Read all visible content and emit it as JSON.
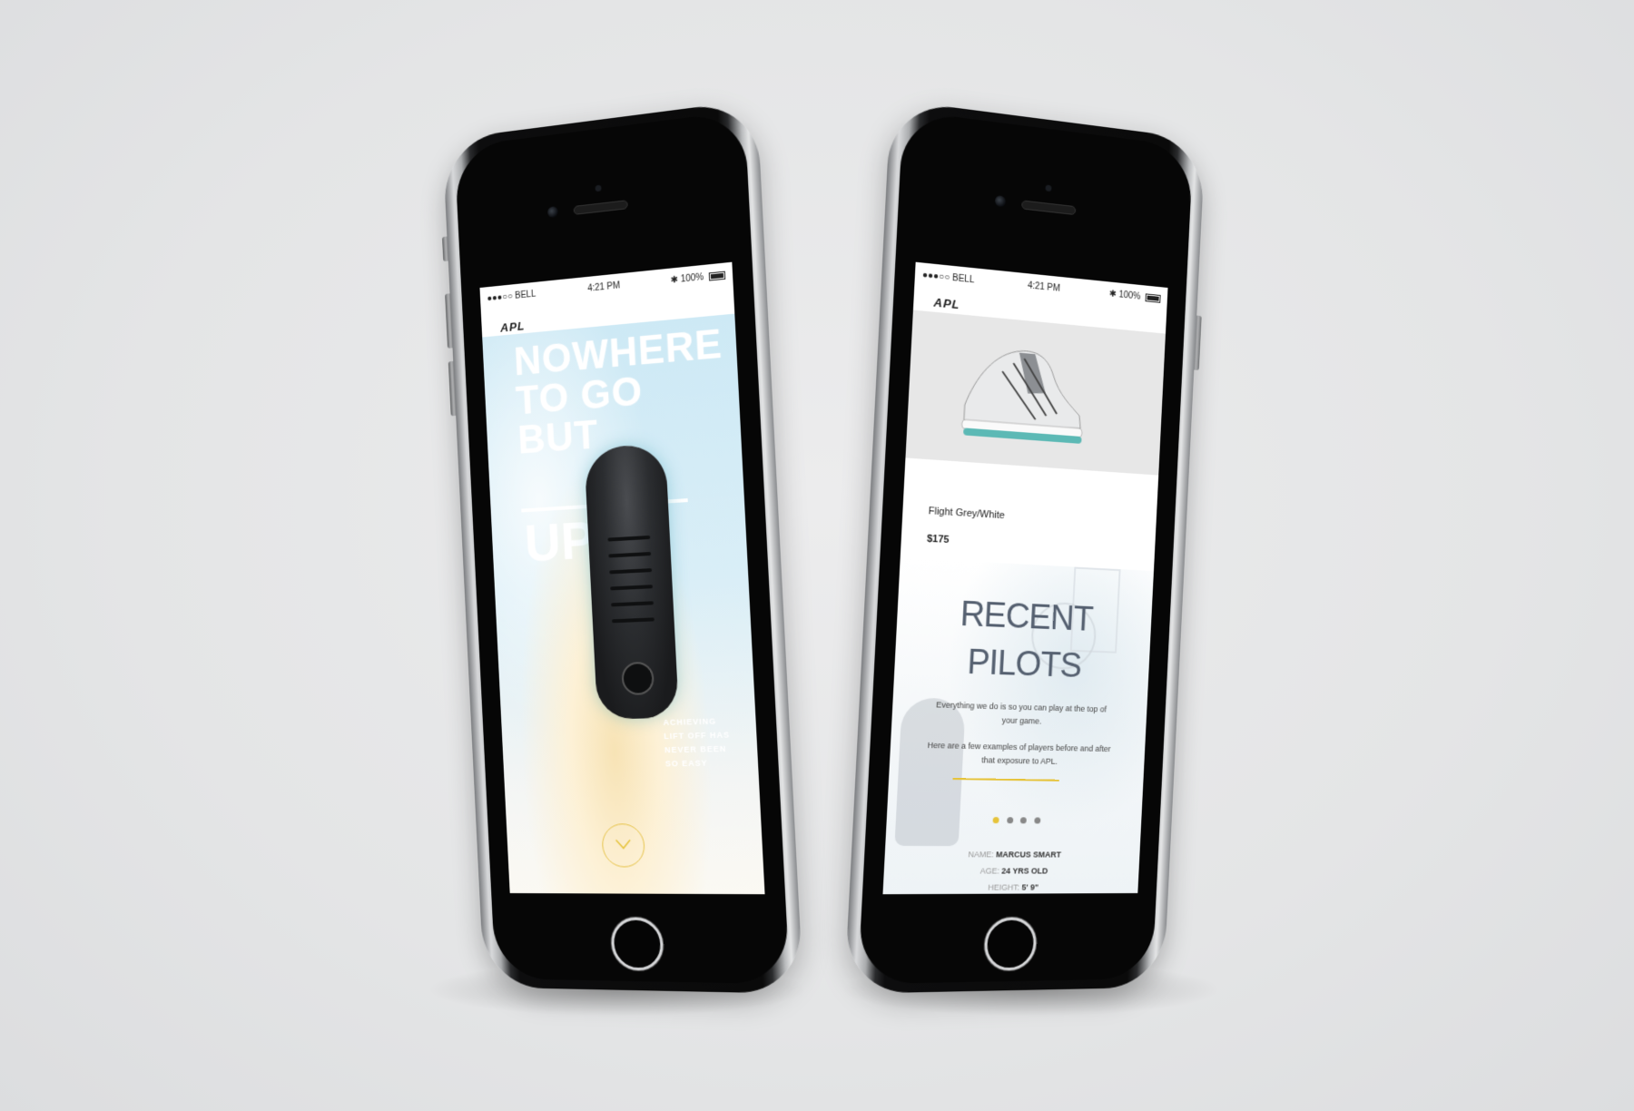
{
  "left_phone": {
    "status": {
      "carrier": "●●●○○ BELL",
      "time": "4:21 PM",
      "battery": "100%"
    },
    "logo": "APL",
    "hero": {
      "line1": "NOWHERE",
      "line2": "TO GO",
      "line3": "BUT",
      "line4": "UP"
    },
    "tagline": {
      "line1": "ACHIEVING",
      "line2": "LIFT OFF HAS",
      "line3": "NEVER BEEN",
      "line4": "SO EASY"
    }
  },
  "right_phone": {
    "status": {
      "carrier": "●●●○○ BELL",
      "time": "4:21 PM",
      "battery": "100%"
    },
    "logo": "APL",
    "product": {
      "name": "Flight Grey/White",
      "price": "$175"
    },
    "pilots": {
      "title1": "RECENT",
      "title2": "PILOTS",
      "para1": "Everything we do is so you can play at the top of your game.",
      "para2": "Here are a few examples of players before and after that exposure to APL.",
      "name_label": "NAME:",
      "name_value": "MARCUS SMART",
      "age_label": "AGE:",
      "age_value": "24 YRS OLD",
      "height_label": "HEIGHT:",
      "height_value": "5' 9\""
    },
    "carousel_active": 1,
    "carousel_count": 4
  },
  "colors": {
    "accent": "#e6c33a",
    "title": "#556070",
    "sky": "#cde9f5"
  },
  "icons": [
    "bluetooth-icon",
    "wifi-icon",
    "battery-icon",
    "chevron-down-icon"
  ]
}
